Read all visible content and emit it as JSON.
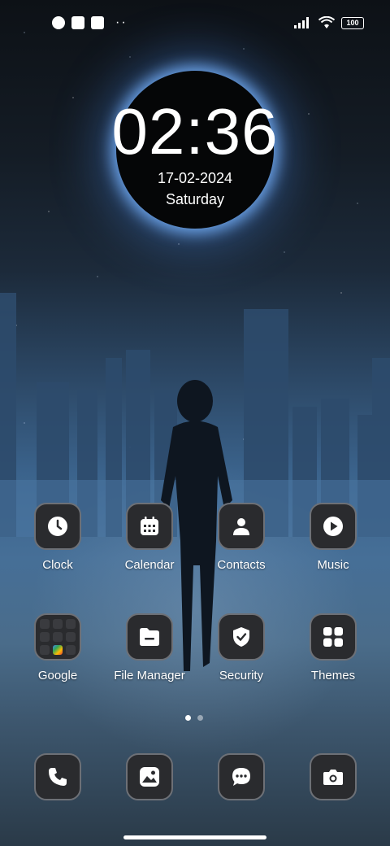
{
  "status_bar": {
    "battery": "100",
    "more_indicator": "··"
  },
  "clock": {
    "time": "02:36",
    "date": "17-02-2024",
    "day": "Saturday"
  },
  "apps_row1": [
    {
      "label": "Clock",
      "icon": "clock-icon"
    },
    {
      "label": "Calendar",
      "icon": "calendar-icon"
    },
    {
      "label": "Contacts",
      "icon": "contacts-icon"
    },
    {
      "label": "Music",
      "icon": "music-icon"
    }
  ],
  "apps_row2": [
    {
      "label": "Google",
      "icon": "google-folder-icon"
    },
    {
      "label": "File Manager",
      "icon": "folder-icon"
    },
    {
      "label": "Security",
      "icon": "shield-icon"
    },
    {
      "label": "Themes",
      "icon": "themes-icon"
    }
  ],
  "dock": [
    {
      "icon": "phone-icon"
    },
    {
      "icon": "gallery-icon"
    },
    {
      "icon": "messages-icon"
    },
    {
      "icon": "camera-icon"
    }
  ],
  "pager": {
    "pages": 2,
    "active": 1
  }
}
